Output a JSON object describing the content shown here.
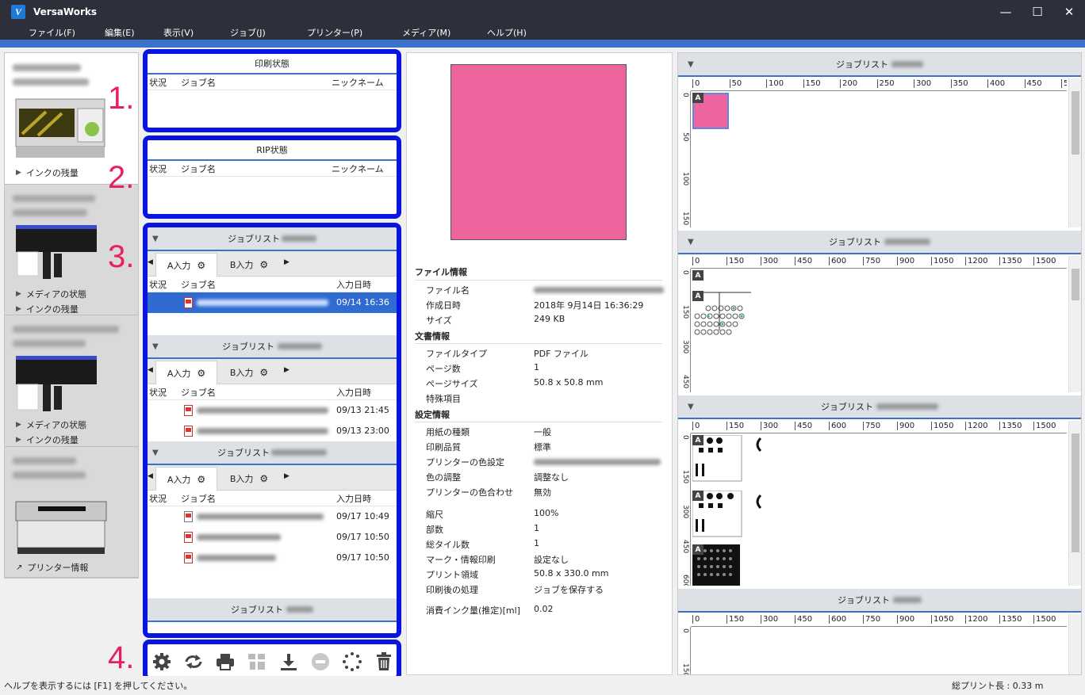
{
  "window": {
    "title": "VersaWorks",
    "minimize": "—",
    "maximize": "☐",
    "close": "✕"
  },
  "menu": [
    "ファイル(F)",
    "編集(E)",
    "表示(V)",
    "ジョブ(J)",
    "プリンター(P)",
    "メディア(M)",
    "ヘルプ(H)"
  ],
  "printers": {
    "ink_link": "インクの残量",
    "media_link": "メディアの状態",
    "printer_info": "プリンター情報"
  },
  "markers": [
    "1.",
    "2.",
    "3.",
    "4."
  ],
  "print_status": {
    "title": "印刷状態",
    "col_status": "状況",
    "col_job": "ジョブ名",
    "col_nick": "ニックネーム"
  },
  "rip_status": {
    "title": "RIP状態",
    "col_status": "状況",
    "col_job": "ジョブ名",
    "col_nick": "ニックネーム"
  },
  "joblists": [
    {
      "title": "ジョブリスト",
      "tab_a": "A入力",
      "tab_b": "B入力",
      "col_status": "状況",
      "col_job": "ジョブ名",
      "col_date": "入力日時",
      "rows": [
        {
          "date": "09/14 16:36"
        }
      ]
    },
    {
      "title": "ジョブリスト",
      "tab_a": "A入力",
      "tab_b": "B入力",
      "col_status": "状況",
      "col_job": "ジョブ名",
      "col_date": "入力日時",
      "rows": [
        {
          "date": "09/13 21:45"
        },
        {
          "date": "09/13 23:00"
        }
      ]
    },
    {
      "title": "ジョブリスト",
      "tab_a": "A入力",
      "tab_b": "B入力",
      "col_status": "状況",
      "col_job": "ジョブ名",
      "col_date": "入力日時",
      "rows": [
        {
          "date": "09/17 10:49"
        },
        {
          "date": "09/17 10:50"
        },
        {
          "date": "09/17 10:50"
        }
      ]
    },
    {
      "title": "ジョブリスト"
    }
  ],
  "toolbar": [
    "settings-icon",
    "refresh-icon",
    "print-icon",
    "nest-icon",
    "download-icon",
    "stop-icon",
    "loading-icon",
    "trash-icon"
  ],
  "file_info": {
    "section_file": "ファイル情報",
    "file_name_label": "ファイル名",
    "created_label": "作成日時",
    "created_value": "2018年 9月14日 16:36:29",
    "size_label": "サイズ",
    "size_value": "249 KB",
    "section_doc": "文書情報",
    "filetype_label": "ファイルタイプ",
    "filetype_value": "PDF ファイル",
    "pages_label": "ページ数",
    "pages_value": "1",
    "pagesize_label": "ページサイズ",
    "pagesize_value": "50.8 x 50.8 mm",
    "special_label": "特殊項目",
    "section_settings": "設定情報",
    "paper_label": "用紙の種類",
    "paper_value": "一般",
    "quality_label": "印刷品質",
    "quality_value": "標準",
    "colorset_label": "プリンターの色設定",
    "coloradj_label": "色の調整",
    "coloradj_value": "調整なし",
    "colormatch_label": "プリンターの色合わせ",
    "colormatch_value": "無効",
    "scale_label": "縮尺",
    "scale_value": "100%",
    "copies_label": "部数",
    "copies_value": "1",
    "tiles_label": "総タイル数",
    "tiles_value": "1",
    "marks_label": "マーク・情報印刷",
    "marks_value": "設定なし",
    "area_label": "プリント領域",
    "area_value": "50.8 x 330.0 mm",
    "post_label": "印刷後の処理",
    "post_value": "ジョブを保存する",
    "ink_label": "消費インク量(推定)[ml]",
    "ink_value": "0.02",
    "preview_color": "#ee649f"
  },
  "right_panels": [
    {
      "title": "ジョブリスト",
      "ticks": [
        "0",
        "50",
        "100",
        "150",
        "200",
        "250",
        "300",
        "350",
        "400",
        "450",
        "5"
      ],
      "vticks": [
        "0",
        "50",
        "100",
        "150"
      ]
    },
    {
      "title": "ジョブリスト",
      "ticks": [
        "0",
        "150",
        "300",
        "450",
        "600",
        "750",
        "900",
        "1050",
        "1200",
        "1350",
        "1500"
      ],
      "vticks": [
        "0",
        "150",
        "300",
        "450"
      ]
    },
    {
      "title": "ジョブリスト",
      "ticks": [
        "0",
        "150",
        "300",
        "450",
        "600",
        "750",
        "900",
        "1050",
        "1200",
        "1350",
        "1500"
      ],
      "vticks": [
        "0",
        "150",
        "300",
        "450",
        "600"
      ]
    },
    {
      "title": "ジョブリスト",
      "ticks": [
        "0",
        "150",
        "300",
        "450",
        "600",
        "750",
        "900",
        "1050",
        "1200",
        "1350",
        "1500"
      ],
      "vticks": [
        "0",
        "150"
      ]
    }
  ],
  "badge": "A",
  "status": {
    "help": "ヘルプを表示するには [F1] を押してください。",
    "total": "総プリント長 : 0.33 m"
  }
}
